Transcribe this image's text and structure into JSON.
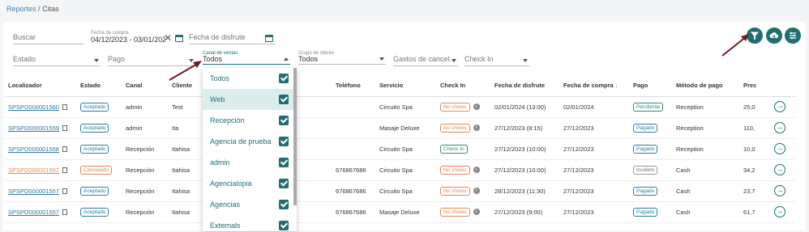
{
  "breadcrumb": {
    "parent": "Reportes",
    "separator": "/",
    "current": "Citas"
  },
  "filters": {
    "search_placeholder": "Buscar",
    "purchase_date_label": "Fecha de compra",
    "purchase_date_value": "04/12/2023 - 03/01/2024",
    "enjoy_date_placeholder": "Fecha de disfrute",
    "estado_placeholder": "Estado",
    "pago_placeholder": "Pago",
    "canal_label": "Canal de ventas",
    "canal_value": "Todos",
    "grupo_label": "Grupo de cliente",
    "grupo_value": "Todos",
    "gastos_placeholder": "Gastos de cancel...",
    "checkin_placeholder": "Check In"
  },
  "toolbar_icons": [
    "filter-icon",
    "cloud-download-icon",
    "sliders-icon"
  ],
  "accent_color": "#1e6f71",
  "dropdown": {
    "items": [
      {
        "label": "Todos",
        "checked": true
      },
      {
        "label": "Web",
        "checked": true
      },
      {
        "label": "Recepción",
        "checked": true
      },
      {
        "label": "Agencia de prueba",
        "checked": true
      },
      {
        "label": "admin",
        "checked": true
      },
      {
        "label": "Agencialopia",
        "checked": true
      },
      {
        "label": "Agencias",
        "checked": true
      },
      {
        "label": "Externals",
        "checked": true
      }
    ]
  },
  "table": {
    "headers": {
      "localizador": "Localizador",
      "estado": "Estado",
      "canal": "Canal",
      "cliente": "Cliente",
      "telefono": "Teléfono",
      "servicio": "Servicio",
      "checkin": "Check In",
      "fecha_disfrute": "Fecha de disfrute",
      "fecha_compra": "Fecha de compra",
      "sort_icon": "↓",
      "pago": "Pago",
      "metodo": "Método de pago",
      "precio": "Prec"
    },
    "rows": [
      {
        "loc": "SPSPD000001560",
        "estado": "Aceptado",
        "canal": "admin",
        "cliente": "Test",
        "tel": "",
        "servicio": "Circuito Spa",
        "checkin": "No shows",
        "disfrute": "02/01/2024 (13:00)",
        "compra": "02/01/2024",
        "pago": "Pendiente",
        "metodo": "Reception",
        "precio": "25,0"
      },
      {
        "loc": "SPSPD000001559",
        "estado": "Aceptado",
        "canal": "admin",
        "cliente": "Ita",
        "tel": "",
        "servicio": "Masaje Deluxe",
        "checkin": "No shows",
        "disfrute": "27/12/2023 (8:15)",
        "compra": "27/12/2023",
        "pago": "Pagado",
        "metodo": "Reception",
        "precio": "110,"
      },
      {
        "loc": "SPSPD000001558",
        "estado": "Aceptado",
        "canal": "Recepción",
        "cliente": "Itahisa",
        "tel": "",
        "servicio": "Circuito Spa",
        "checkin": "Check In",
        "disfrute": "27/12/2023 (10:00)",
        "compra": "27/12/2023",
        "pago": "Pagado",
        "metodo": "Reception",
        "precio": "10,0"
      },
      {
        "loc": "SPSPD000001557",
        "estado": "Cancelado",
        "canal": "Recepción",
        "cliente": "Itahisa",
        "tel": "676867686",
        "servicio": "Circuito Spa",
        "checkin": "No shows",
        "disfrute": "27/12/2023 (10:00)",
        "compra": "27/12/2023",
        "pago": "Inválido",
        "metodo": "Cash",
        "precio": "34,2"
      },
      {
        "loc": "SPSPD000001557",
        "estado": "Aceptado",
        "canal": "Recepción",
        "cliente": "Itahisa",
        "tel": "676867686",
        "servicio": "Circuito Spa",
        "checkin": "No shows",
        "disfrute": "28/12/2023 (11:30)",
        "compra": "27/12/2023",
        "pago": "Pagado",
        "metodo": "Cash",
        "precio": "23,7"
      },
      {
        "loc": "SPSPD000001557",
        "estado": "Aceptado",
        "canal": "Recepción",
        "cliente": "Itahisa",
        "tel": "676867686",
        "servicio": "Masaje Deluxe",
        "checkin": "No shows",
        "disfrute": "27/12/2023 (9:00)",
        "compra": "27/12/2023",
        "pago": "Pagado",
        "metodo": "Cash",
        "precio": "61,7"
      }
    ]
  }
}
